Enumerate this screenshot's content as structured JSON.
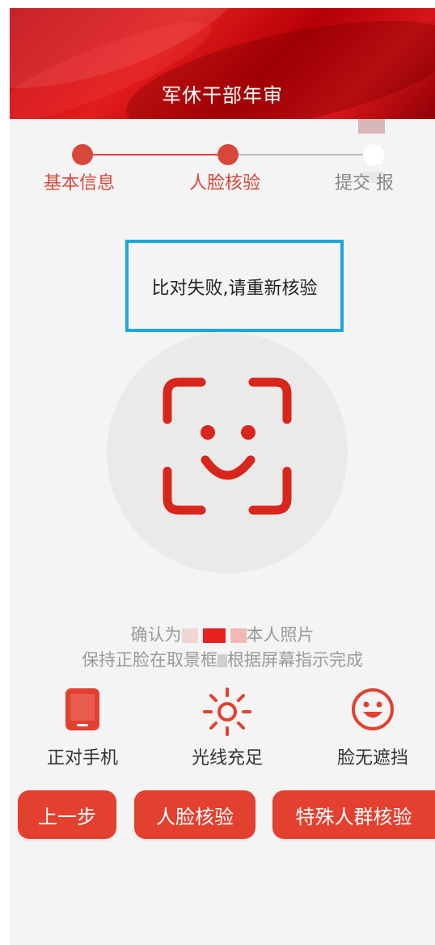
{
  "header": {
    "title": "军休干部年审"
  },
  "steps": [
    {
      "label": "基本信息",
      "state": "done"
    },
    {
      "label": "人脸核验",
      "state": "active"
    },
    {
      "label": "提交申报",
      "label_visible": "提交 报",
      "state": "pending"
    }
  ],
  "alert": {
    "message": "比对失败,请重新核验"
  },
  "face_scan": {
    "icon": "face-scan-icon",
    "color": "#d9261c"
  },
  "confirm": {
    "line1_prefix": "确认为",
    "line1_suffix": "本人照片",
    "line2_prefix": "保持正脸在取景框",
    "line2_suffix": "根据屏幕指示完成"
  },
  "tips": [
    {
      "icon": "phone-icon",
      "label": "正对手机"
    },
    {
      "icon": "sun-icon",
      "label": "光线充足"
    },
    {
      "icon": "smile-icon",
      "label": "脸无遮挡"
    }
  ],
  "buttons": {
    "prev": "上一步",
    "face_verify": "人脸核验",
    "special_verify": "特殊人群核验"
  },
  "colors": {
    "accent": "#e3402f",
    "header_red": "#c20a10",
    "alert_border": "#1aa8df",
    "icon_red": "#d9261c"
  }
}
